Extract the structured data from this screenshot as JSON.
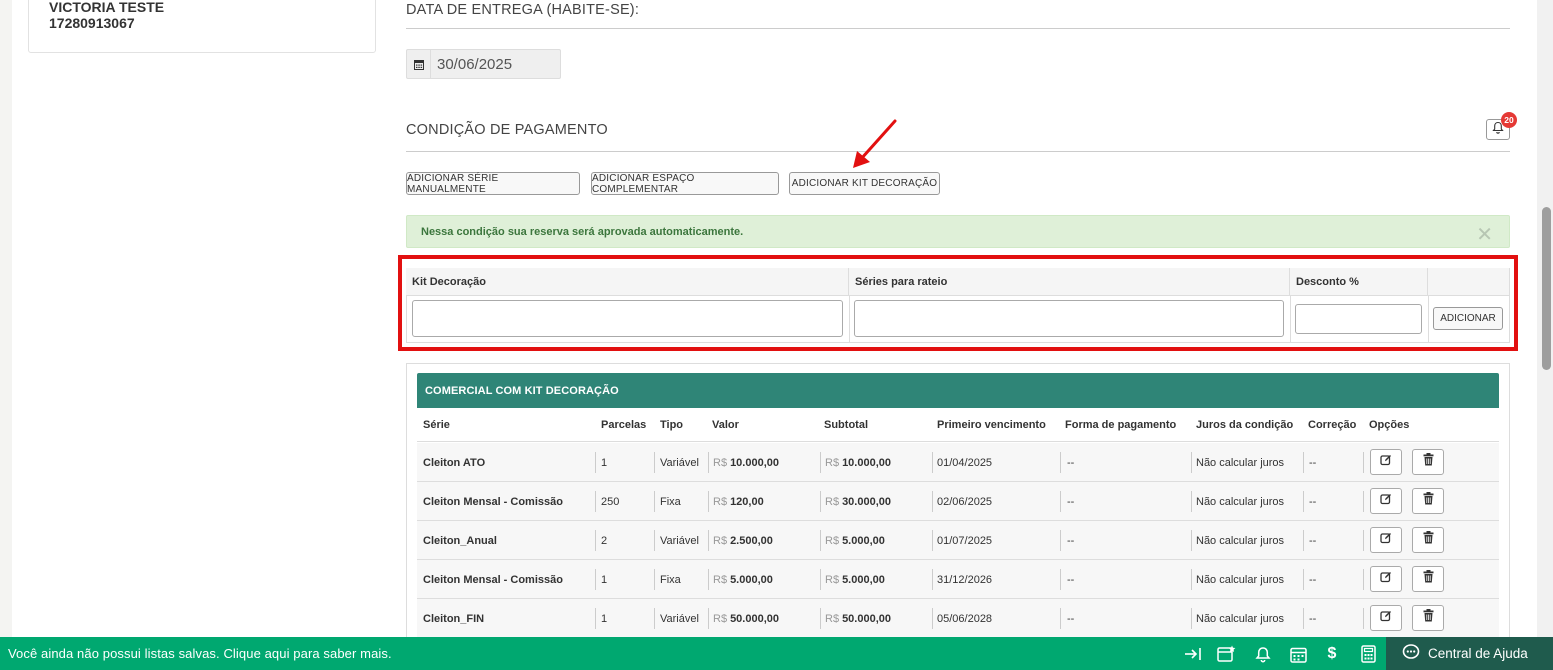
{
  "client": {
    "name": "VICTORIA TESTE",
    "code": "17280913067"
  },
  "delivery": {
    "title": "DATA DE ENTREGA (HABITE-SE):",
    "date": "30/06/2025"
  },
  "payment": {
    "title": "CONDIÇÃO DE PAGAMENTO",
    "notifications": "20",
    "buttons": {
      "add_series": "ADICIONAR SÉRIE MANUALMENTE",
      "add_space": "ADICIONAR ESPAÇO COMPLEMENTAR",
      "add_kit": "ADICIONAR KIT DECORAÇÃO"
    },
    "alert": "Nessa condição sua reserva será aprovada automaticamente.",
    "alert_close": "✕"
  },
  "kit_form": {
    "col_kit": "Kit Decoração",
    "col_series": "Séries para rateio",
    "col_discount": "Desconto %",
    "add_label": "ADICIONAR"
  },
  "series_table": {
    "title": "COMERCIAL COM KIT DECORAÇÃO",
    "headers": [
      "Série",
      "Parcelas",
      "Tipo",
      "Valor",
      "Subtotal",
      "Primeiro vencimento",
      "Forma de pagamento",
      "Juros da condição",
      "Correção",
      "Opções"
    ],
    "currency": "R$",
    "rows": [
      {
        "serie": "Cleiton ATO",
        "parcelas": "1",
        "tipo": "Variável",
        "valor": "10.000,00",
        "subtotal": "10.000,00",
        "vencimento": "01/04/2025",
        "forma": "--",
        "juros": "Não calcular juros",
        "correcao": "--"
      },
      {
        "serie": "Cleiton Mensal - Comissão",
        "parcelas": "250",
        "tipo": "Fixa",
        "valor": "120,00",
        "subtotal": "30.000,00",
        "vencimento": "02/06/2025",
        "forma": "--",
        "juros": "Não calcular juros",
        "correcao": "--"
      },
      {
        "serie": "Cleiton_Anual",
        "parcelas": "2",
        "tipo": "Variável",
        "valor": "2.500,00",
        "subtotal": "5.000,00",
        "vencimento": "01/07/2025",
        "forma": "--",
        "juros": "Não calcular juros",
        "correcao": "--"
      },
      {
        "serie": "Cleiton Mensal - Comissão",
        "parcelas": "1",
        "tipo": "Fixa",
        "valor": "5.000,00",
        "subtotal": "5.000,00",
        "vencimento": "31/12/2026",
        "forma": "--",
        "juros": "Não calcular juros",
        "correcao": "--"
      },
      {
        "serie": "Cleiton_FIN",
        "parcelas": "1",
        "tipo": "Variável",
        "valor": "50.000,00",
        "subtotal": "50.000,00",
        "vencimento": "05/06/2028",
        "forma": "--",
        "juros": "Não calcular juros",
        "correcao": "--"
      }
    ]
  },
  "bottom_bar": {
    "message": "Você ainda não possui listas salvas. Clique aqui para saber mais.",
    "help": "Central de Ajuda",
    "icons": [
      "collapse-icon",
      "calendar-star-icon",
      "bell-icon",
      "calendar-icon",
      "dollar-icon",
      "calculator-icon"
    ]
  },
  "colors": {
    "accent": "#00a870",
    "table_header": "#2f8577",
    "help_bg": "#1f5b4d",
    "highlight": "#e21010"
  }
}
